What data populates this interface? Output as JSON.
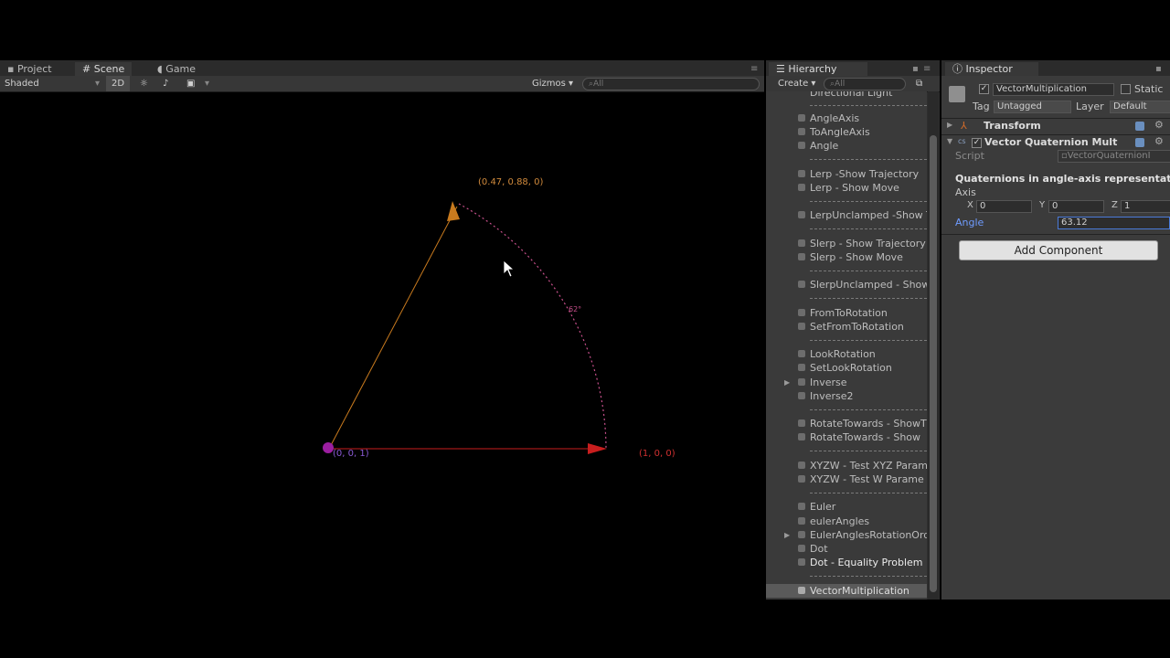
{
  "scene": {
    "tabs": {
      "project": "Project",
      "scene": "Scene",
      "game": "Game"
    },
    "toolbar": {
      "shading": "Shaded",
      "mode_2d": "2D",
      "gizmos": "Gizmos",
      "search_placeholder": "All"
    },
    "labels": {
      "tip": "(0.47, 0.88, 0)",
      "origin": "(0, 0, 1)",
      "x_axis": "(1, 0, 0)",
      "angle": "62°"
    },
    "colors": {
      "vector_up": "#c87a1e",
      "vector_x": "#c81e1e",
      "arc": "#c8508c",
      "origin_dot": "#9b1ea0",
      "origin_label": "#8a5ad6",
      "tip_label": "#d08a3c",
      "x_label": "#d03030"
    }
  },
  "hierarchy": {
    "title": "Hierarchy",
    "create_label": "Create",
    "search_placeholder": "All",
    "items": [
      {
        "label": "Directional Light"
      },
      {
        "label": "AngleAxis"
      },
      {
        "label": "ToAngleAxis"
      },
      {
        "label": "Angle"
      },
      {
        "label": "Lerp -Show Trajectory"
      },
      {
        "label": "Lerp - Show Move"
      },
      {
        "label": "LerpUnclamped -Show T"
      },
      {
        "label": "Slerp - Show Trajectory"
      },
      {
        "label": "Slerp - Show Move"
      },
      {
        "label": "SlerpUnclamped - Show"
      },
      {
        "label": "FromToRotation"
      },
      {
        "label": "SetFromToRotation"
      },
      {
        "label": "LookRotation"
      },
      {
        "label": "SetLookRotation"
      },
      {
        "label": "Inverse"
      },
      {
        "label": "Inverse2"
      },
      {
        "label": "RotateTowards - ShowT"
      },
      {
        "label": "RotateTowards - Show"
      },
      {
        "label": "XYZW - Test XYZ Param"
      },
      {
        "label": "XYZW - Test W Parame"
      },
      {
        "label": "Euler"
      },
      {
        "label": "eulerAngles"
      },
      {
        "label": "EulerAnglesRotationOrd"
      },
      {
        "label": "Dot"
      },
      {
        "label": "Dot - Equality Problem"
      },
      {
        "label": "VectorMultiplication"
      }
    ]
  },
  "inspector": {
    "title": "Inspector",
    "object_name": "VectorMultiplication",
    "static_label": "Static",
    "tag_label": "Tag",
    "tag_value": "Untagged",
    "layer_label": "Layer",
    "layer_value": "Default",
    "transform_label": "Transform",
    "component_label": "Vector Quaternion Mult",
    "script_label": "Script",
    "script_value": "VectorQuaternionI",
    "section_header": "Quaternions in angle-axis representat",
    "axis_label": "Axis",
    "x_label": "X",
    "x_value": "0",
    "y_label": "Y",
    "y_value": "0",
    "z_label": "Z",
    "z_value": "1",
    "angle_label": "Angle",
    "angle_value": "63.12",
    "add_component": "Add Component"
  }
}
